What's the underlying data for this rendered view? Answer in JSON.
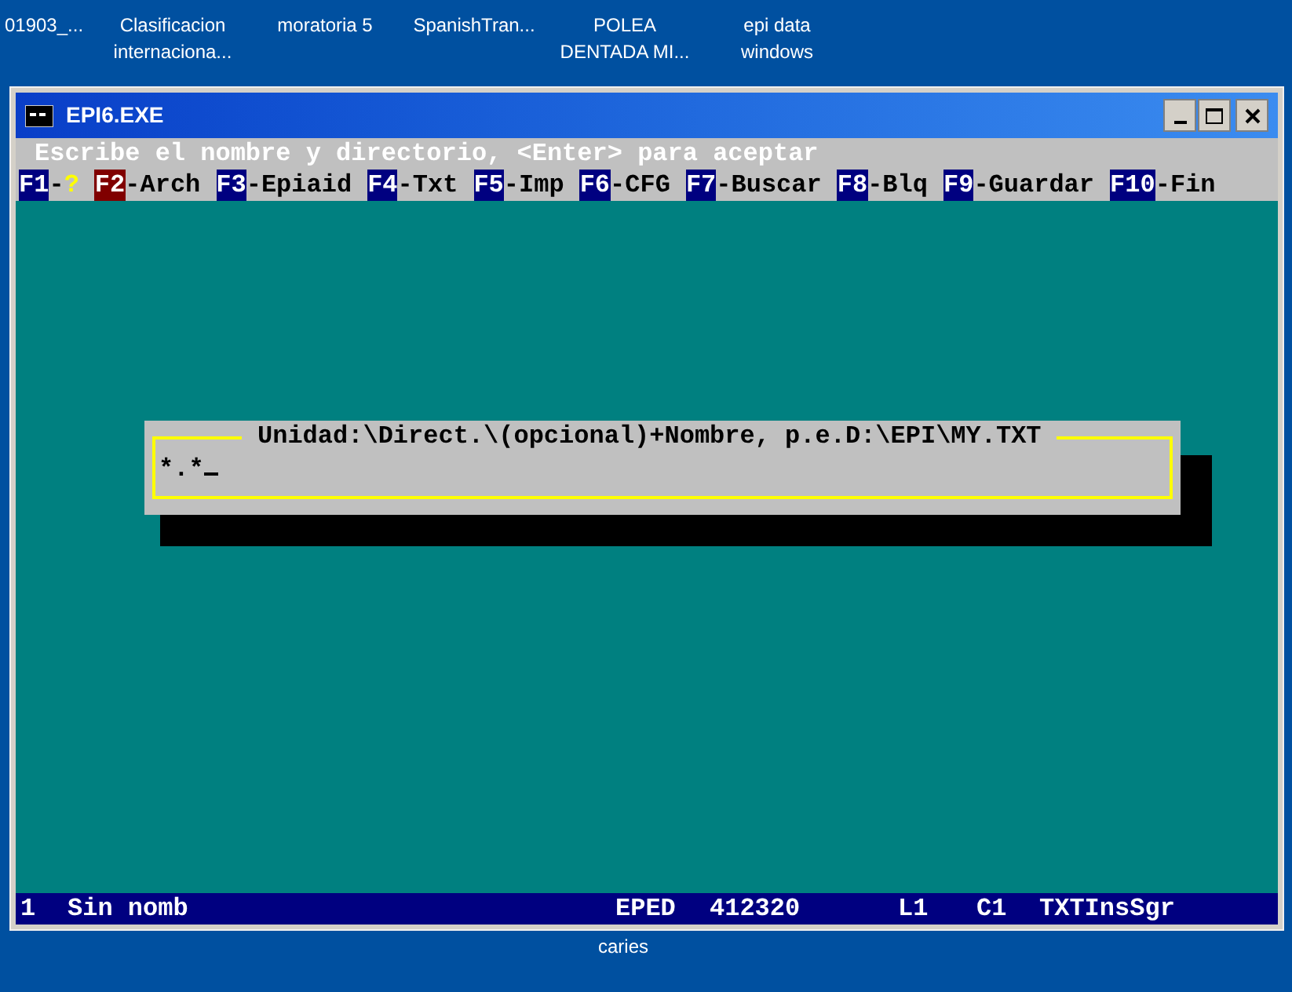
{
  "desktop_icons": [
    {
      "lines": [
        "01903_..."
      ]
    },
    {
      "lines": [
        "Clasificacion",
        "internaciona..."
      ]
    },
    {
      "lines": [
        "moratoria 5"
      ]
    },
    {
      "lines": [
        "SpanishTran..."
      ]
    },
    {
      "lines": [
        "POLEA",
        "DENTADA MI..."
      ]
    },
    {
      "lines": [
        "epi data",
        "windows"
      ]
    },
    {
      "lines": [
        "caries"
      ]
    }
  ],
  "window": {
    "title": "EPI6.EXE"
  },
  "prompt": "Escribe el nombre y directorio, <Enter> para aceptar",
  "menu": [
    {
      "key": "F1",
      "sep": "-",
      "label": "?",
      "selected": false,
      "color": "#ffff00"
    },
    {
      "key": "F2",
      "sep": "-",
      "label": "Arch",
      "selected": true,
      "color": "#000000"
    },
    {
      "key": "F3",
      "sep": "-",
      "label": "Epiaid",
      "selected": false,
      "color": "#000000"
    },
    {
      "key": "F4",
      "sep": "-",
      "label": "Txt",
      "selected": false,
      "color": "#000000"
    },
    {
      "key": "F5",
      "sep": "-",
      "label": "Imp",
      "selected": false,
      "color": "#000000"
    },
    {
      "key": "F6",
      "sep": "-",
      "label": "CFG",
      "selected": false,
      "color": "#000000"
    },
    {
      "key": "F7",
      "sep": "-",
      "label": "Buscar",
      "selected": false,
      "color": "#000000"
    },
    {
      "key": "F8",
      "sep": "-",
      "label": "Blq",
      "selected": false,
      "color": "#000000"
    },
    {
      "key": "F9",
      "sep": "-",
      "label": "Guardar",
      "selected": false,
      "color": "#000000"
    },
    {
      "key": "F10",
      "sep": "-",
      "label": "Fin",
      "selected": false,
      "color": "#000000"
    }
  ],
  "dialog": {
    "title": "Unidad:\\Direct.\\(opcional)+Nombre, p.e.D:\\EPI\\MY.TXT",
    "value": "*.*"
  },
  "status_bar": [
    "1",
    "Sin nomb",
    "EPED",
    "412320",
    "L1",
    "C1",
    "TXTInsSgr"
  ]
}
